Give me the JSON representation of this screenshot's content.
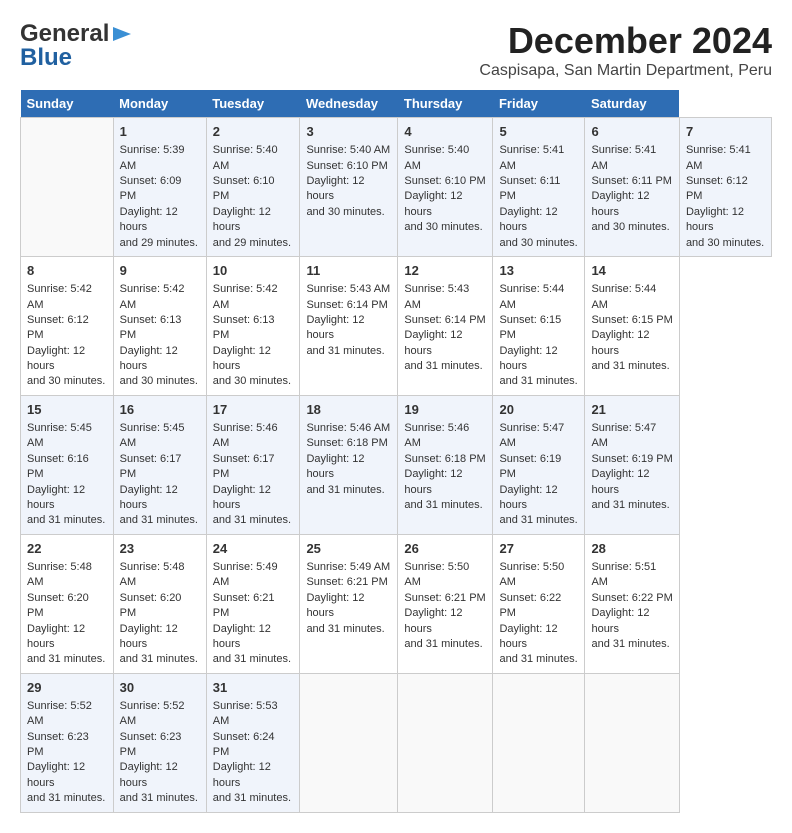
{
  "header": {
    "logo_line1": "General",
    "logo_line2": "Blue",
    "main_title": "December 2024",
    "subtitle": "Caspisapa, San Martin Department, Peru"
  },
  "calendar": {
    "days_of_week": [
      "Sunday",
      "Monday",
      "Tuesday",
      "Wednesday",
      "Thursday",
      "Friday",
      "Saturday"
    ],
    "weeks": [
      [
        {
          "day": "",
          "text": ""
        },
        {
          "day": "1",
          "text": "Sunrise: 5:39 AM\nSunset: 6:09 PM\nDaylight: 12 hours\nand 29 minutes."
        },
        {
          "day": "2",
          "text": "Sunrise: 5:40 AM\nSunset: 6:10 PM\nDaylight: 12 hours\nand 29 minutes."
        },
        {
          "day": "3",
          "text": "Sunrise: 5:40 AM\nSunset: 6:10 PM\nDaylight: 12 hours\nand 30 minutes."
        },
        {
          "day": "4",
          "text": "Sunrise: 5:40 AM\nSunset: 6:10 PM\nDaylight: 12 hours\nand 30 minutes."
        },
        {
          "day": "5",
          "text": "Sunrise: 5:41 AM\nSunset: 6:11 PM\nDaylight: 12 hours\nand 30 minutes."
        },
        {
          "day": "6",
          "text": "Sunrise: 5:41 AM\nSunset: 6:11 PM\nDaylight: 12 hours\nand 30 minutes."
        },
        {
          "day": "7",
          "text": "Sunrise: 5:41 AM\nSunset: 6:12 PM\nDaylight: 12 hours\nand 30 minutes."
        }
      ],
      [
        {
          "day": "8",
          "text": "Sunrise: 5:42 AM\nSunset: 6:12 PM\nDaylight: 12 hours\nand 30 minutes."
        },
        {
          "day": "9",
          "text": "Sunrise: 5:42 AM\nSunset: 6:13 PM\nDaylight: 12 hours\nand 30 minutes."
        },
        {
          "day": "10",
          "text": "Sunrise: 5:42 AM\nSunset: 6:13 PM\nDaylight: 12 hours\nand 30 minutes."
        },
        {
          "day": "11",
          "text": "Sunrise: 5:43 AM\nSunset: 6:14 PM\nDaylight: 12 hours\nand 31 minutes."
        },
        {
          "day": "12",
          "text": "Sunrise: 5:43 AM\nSunset: 6:14 PM\nDaylight: 12 hours\nand 31 minutes."
        },
        {
          "day": "13",
          "text": "Sunrise: 5:44 AM\nSunset: 6:15 PM\nDaylight: 12 hours\nand 31 minutes."
        },
        {
          "day": "14",
          "text": "Sunrise: 5:44 AM\nSunset: 6:15 PM\nDaylight: 12 hours\nand 31 minutes."
        }
      ],
      [
        {
          "day": "15",
          "text": "Sunrise: 5:45 AM\nSunset: 6:16 PM\nDaylight: 12 hours\nand 31 minutes."
        },
        {
          "day": "16",
          "text": "Sunrise: 5:45 AM\nSunset: 6:17 PM\nDaylight: 12 hours\nand 31 minutes."
        },
        {
          "day": "17",
          "text": "Sunrise: 5:46 AM\nSunset: 6:17 PM\nDaylight: 12 hours\nand 31 minutes."
        },
        {
          "day": "18",
          "text": "Sunrise: 5:46 AM\nSunset: 6:18 PM\nDaylight: 12 hours\nand 31 minutes."
        },
        {
          "day": "19",
          "text": "Sunrise: 5:46 AM\nSunset: 6:18 PM\nDaylight: 12 hours\nand 31 minutes."
        },
        {
          "day": "20",
          "text": "Sunrise: 5:47 AM\nSunset: 6:19 PM\nDaylight: 12 hours\nand 31 minutes."
        },
        {
          "day": "21",
          "text": "Sunrise: 5:47 AM\nSunset: 6:19 PM\nDaylight: 12 hours\nand 31 minutes."
        }
      ],
      [
        {
          "day": "22",
          "text": "Sunrise: 5:48 AM\nSunset: 6:20 PM\nDaylight: 12 hours\nand 31 minutes."
        },
        {
          "day": "23",
          "text": "Sunrise: 5:48 AM\nSunset: 6:20 PM\nDaylight: 12 hours\nand 31 minutes."
        },
        {
          "day": "24",
          "text": "Sunrise: 5:49 AM\nSunset: 6:21 PM\nDaylight: 12 hours\nand 31 minutes."
        },
        {
          "day": "25",
          "text": "Sunrise: 5:49 AM\nSunset: 6:21 PM\nDaylight: 12 hours\nand 31 minutes."
        },
        {
          "day": "26",
          "text": "Sunrise: 5:50 AM\nSunset: 6:21 PM\nDaylight: 12 hours\nand 31 minutes."
        },
        {
          "day": "27",
          "text": "Sunrise: 5:50 AM\nSunset: 6:22 PM\nDaylight: 12 hours\nand 31 minutes."
        },
        {
          "day": "28",
          "text": "Sunrise: 5:51 AM\nSunset: 6:22 PM\nDaylight: 12 hours\nand 31 minutes."
        }
      ],
      [
        {
          "day": "29",
          "text": "Sunrise: 5:52 AM\nSunset: 6:23 PM\nDaylight: 12 hours\nand 31 minutes."
        },
        {
          "day": "30",
          "text": "Sunrise: 5:52 AM\nSunset: 6:23 PM\nDaylight: 12 hours\nand 31 minutes."
        },
        {
          "day": "31",
          "text": "Sunrise: 5:53 AM\nSunset: 6:24 PM\nDaylight: 12 hours\nand 31 minutes."
        },
        {
          "day": "",
          "text": ""
        },
        {
          "day": "",
          "text": ""
        },
        {
          "day": "",
          "text": ""
        },
        {
          "day": "",
          "text": ""
        }
      ]
    ]
  }
}
